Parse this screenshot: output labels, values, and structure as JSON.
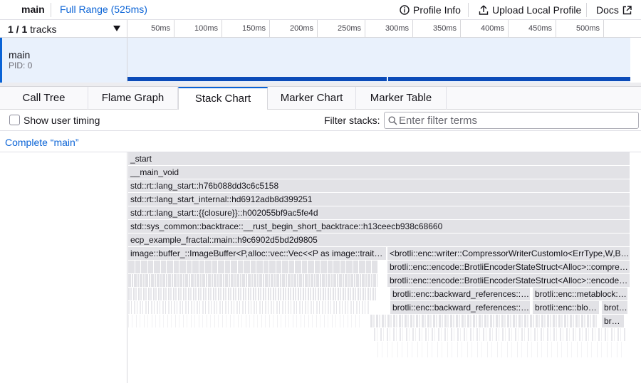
{
  "topbar": {
    "thread": "main",
    "range": "Full Range (525ms)",
    "profile_info": "Profile Info",
    "upload": "Upload Local Profile",
    "docs": "Docs"
  },
  "timeline": {
    "tracks_count": "1 / 1",
    "tracks_label": "tracks",
    "ticks": [
      "50ms",
      "100ms",
      "150ms",
      "200ms",
      "250ms",
      "300ms",
      "350ms",
      "400ms",
      "450ms",
      "500ms"
    ]
  },
  "track": {
    "name": "main",
    "pid": "PID: 0"
  },
  "tabs": [
    "Call Tree",
    "Flame Graph",
    "Stack Chart",
    "Marker Chart",
    "Marker Table"
  ],
  "selected_tab": "Stack Chart",
  "settings": {
    "show_user_timing": "Show user timing",
    "filter_label": "Filter stacks:",
    "filter_placeholder": "Enter filter terms"
  },
  "breadcrumb": "Complete “main”",
  "stack": {
    "d0": "_start",
    "d1": "__main_void",
    "d2": "std::rt::lang_start::h76b088dd3c6c5158",
    "d3": "std::rt::lang_start_internal::hd6912adb8d399251",
    "d4": "std::rt::lang_start::{{closure}}::h002055bf9ac5fe4d",
    "d5": "std::sys_common::backtrace::__rust_begin_short_backtrace::h13ceecb938c68660",
    "d6": "ecp_example_fractal::main::h9c6902d5bd2d9805",
    "d7a": "image::buffer_::ImageBuffer<P,alloc::vec::Vec<<P as image::traits::Pixel>::Subpixel>>::save",
    "d7b": "<brotli::enc::writer::CompressorWriterCustomIo<ErrType,W,BufferType,Alloc> as std::io::Write>::write",
    "d8b": "brotli::enc::encode::BrotliEncoderStateStruct<Alloc>::compress_stream",
    "d9b": "brotli::enc::encode::BrotliEncoderStateStruct<Alloc>::encode_data",
    "d10a": "brotli::enc::backward_references::BrotliCreateBackwardReferences",
    "d10b": "brotli::enc::metablock::BrotliBuildMetaBlock",
    "d11a": "brotli::enc::backward_references::CreateBackwardReferences",
    "d11b": "brotli::enc::block_splitter::BrotliSplitBlock",
    "d11c": "brotli::enc::histogram::BrotliPopulationCost",
    "d12c": "brotli::enc::bit_cost::BrotliPopulationCost"
  }
}
